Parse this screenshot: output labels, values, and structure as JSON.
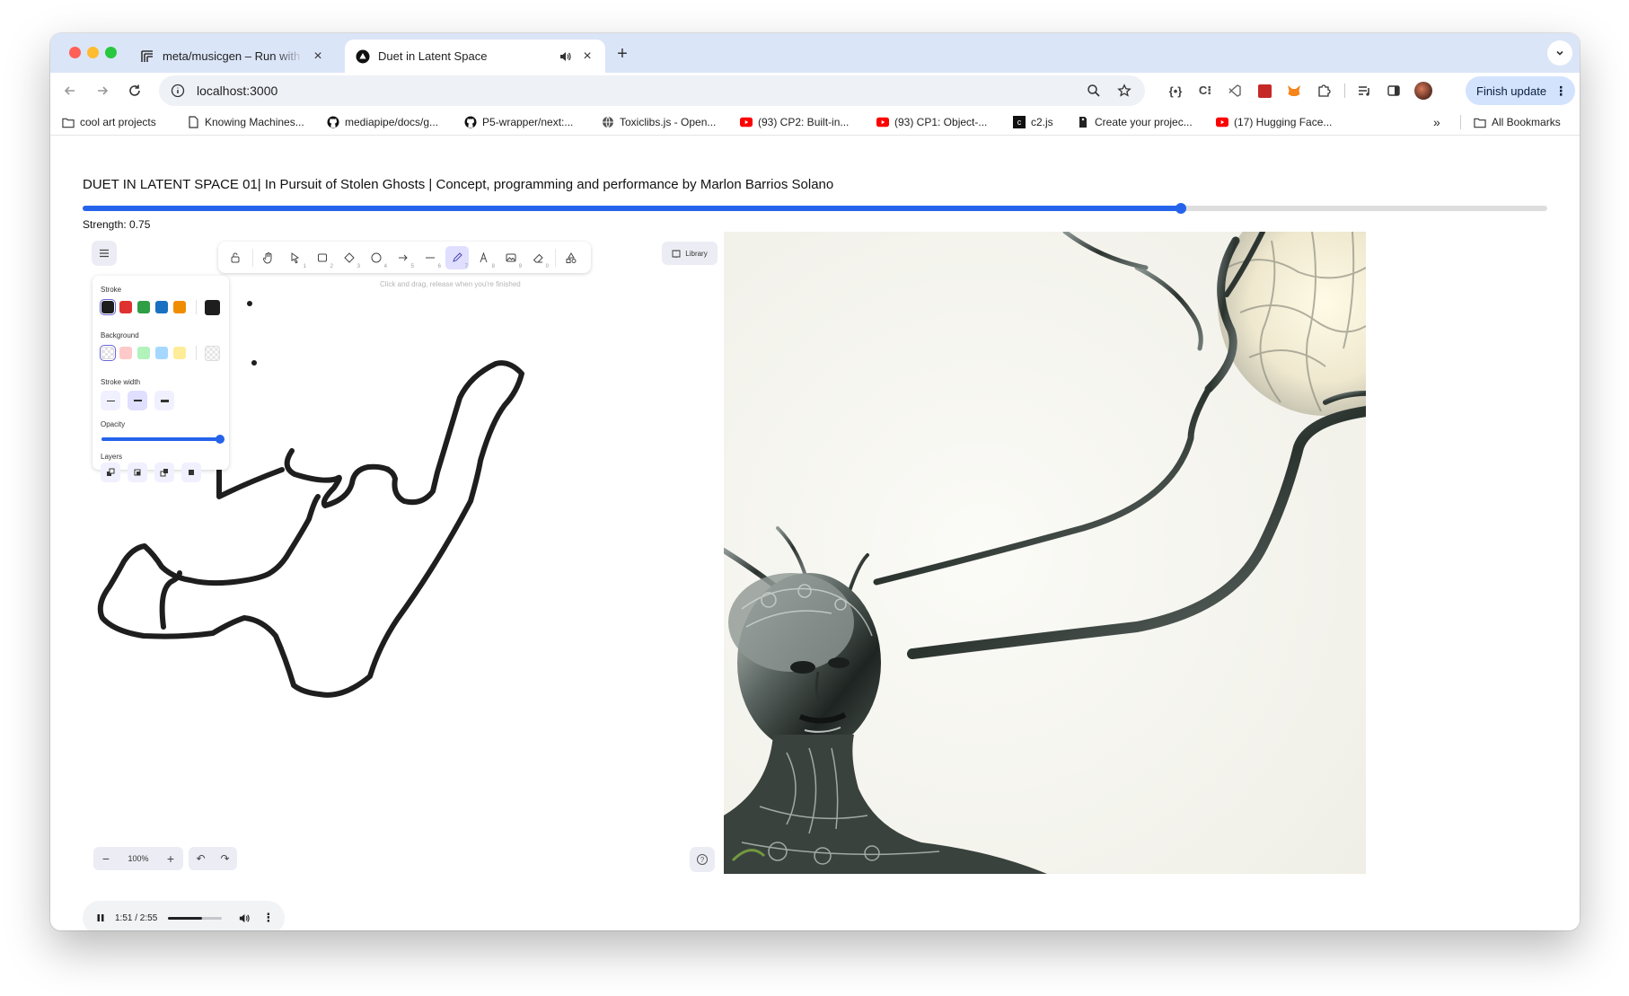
{
  "browser": {
    "tabs": [
      {
        "title": "meta/musicgen – Run with an API on Replicate",
        "icon": "replicate-icon"
      },
      {
        "title": "Duet in Latent Space",
        "icon": "vercel-triangle-icon",
        "audio": true
      }
    ],
    "new_tab": "+",
    "url": "localhost:3000",
    "update_button": "Finish update",
    "accent": "#d3e3fd"
  },
  "bookmarks": [
    {
      "label": "cool art projects",
      "icon": "folder-icon"
    },
    {
      "label": "Knowing Machines...",
      "icon": "page-icon"
    },
    {
      "label": "mediapipe/docs/g...",
      "icon": "github-icon"
    },
    {
      "label": "P5-wrapper/next:...",
      "icon": "github-icon"
    },
    {
      "label": "Toxiclibs.js - Open...",
      "icon": "globe-icon"
    },
    {
      "label": "(93) CP2: Built-in...",
      "icon": "youtube-icon"
    },
    {
      "label": "(93) CP1: Object-...",
      "icon": "youtube-icon"
    },
    {
      "label": "c2.js",
      "icon": "c2-icon"
    },
    {
      "label": "Create your projec...",
      "icon": "tag-icon"
    },
    {
      "label": "(17) Hugging Face...",
      "icon": "youtube-icon"
    }
  ],
  "bookmarks_more": "»",
  "bookmarks_all": "All Bookmarks",
  "page": {
    "title": "DUET IN LATENT SPACE 01| In Pursuit of Stolen Ghosts | Concept, programming and performance by Marlon Barrios Solano",
    "strength_label": "Strength: 0.75",
    "strength_value": 0.75,
    "accent": "#2563eb"
  },
  "editor": {
    "tools": [
      {
        "name": "lock-icon",
        "key": ""
      },
      {
        "name": "hand-icon",
        "key": ""
      },
      {
        "name": "select-icon",
        "key": "1"
      },
      {
        "name": "rectangle-icon",
        "key": "2"
      },
      {
        "name": "diamond-icon",
        "key": "3"
      },
      {
        "name": "ellipse-icon",
        "key": "4"
      },
      {
        "name": "arrow-icon",
        "key": "5"
      },
      {
        "name": "line-icon",
        "key": "6"
      },
      {
        "name": "pencil-icon",
        "key": "7",
        "active": true
      },
      {
        "name": "text-icon",
        "key": "8"
      },
      {
        "name": "image-icon",
        "key": "9"
      },
      {
        "name": "eraser-icon",
        "key": "0"
      },
      {
        "name": "shapes-icon",
        "key": ""
      }
    ],
    "library_label": "Library",
    "hint": "Click and drag, release when you're finished",
    "props": {
      "stroke_label": "Stroke",
      "stroke_colors": [
        "#1e1e1e",
        "#e03131",
        "#2f9e44",
        "#1971c2",
        "#f08c00"
      ],
      "stroke_current": "#1e1e1e",
      "background_label": "Background",
      "background_colors": [
        "transparent",
        "#ffc9c9",
        "#b2f2bb",
        "#a5d8ff",
        "#ffec99"
      ],
      "background_current": "transparent",
      "stroke_width_label": "Stroke width",
      "opacity_label": "Opacity",
      "opacity_value": 1.0,
      "layers_label": "Layers"
    },
    "zoom": "100%",
    "zoom_out": "−",
    "zoom_in": "+",
    "undo": "↶",
    "redo": "↷",
    "help": "?"
  },
  "audio_player": {
    "time": "1:51 / 2:55",
    "progress": 0.634
  }
}
